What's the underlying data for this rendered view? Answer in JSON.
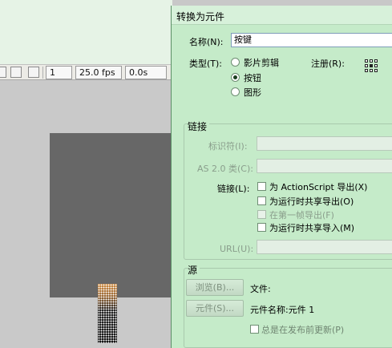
{
  "toolbar": {
    "frame_number": "1",
    "frame_rate": "25.0 fps",
    "elapsed_time": "0.0s"
  },
  "dialog": {
    "title": "转换为元件",
    "name_label": "名称(N):",
    "name_value": "按键",
    "type_label": "类型(T):",
    "type_options": [
      "影片剪辑",
      "按钮",
      "图形"
    ],
    "registration_label": "注册(R):",
    "linkage": {
      "title": "链接",
      "identifier_label": "标识符(I):",
      "class_label": "AS 2.0 类(C):",
      "linkage_label": "链接(L):",
      "options": [
        "为 ActionScript 导出(X)",
        "为运行时共享导出(O)",
        "在第一帧导出(F)",
        "为运行时共享导入(M)"
      ],
      "url_label": "URL(U):"
    },
    "source": {
      "title": "源",
      "browse_button": "浏览(B)...",
      "file_label": "文件:",
      "symbol_button": "元件(S)...",
      "symbol_name": "元件名称:元件 1",
      "always_update_label": "总是在发布前更新(P)"
    }
  }
}
